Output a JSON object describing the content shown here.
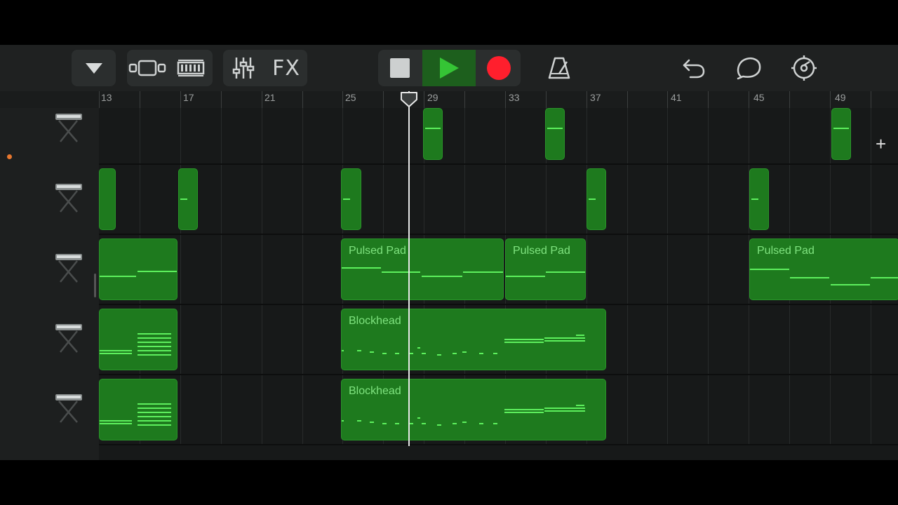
{
  "toolbar": {
    "fx_label": "FX",
    "icons": [
      "dropdown-triangle-icon",
      "tracks-view-icon",
      "live-loops-icon",
      "mixer-icon",
      "stop-icon",
      "play-icon",
      "record-icon",
      "metronome-icon",
      "undo-icon",
      "loop-browser-icon",
      "settings-gear-icon"
    ],
    "colors": {
      "play": "#35c435",
      "record": "#ff1f2d",
      "play_bg": "#1d5f1d"
    }
  },
  "ruler": {
    "bars": [
      "13",
      "17",
      "21",
      "25",
      "29",
      "33",
      "37",
      "41",
      "45",
      "49"
    ],
    "add_label": "+"
  },
  "tracks": [
    {
      "name": "keyboard-track-1",
      "instrument_icon": "keyboard-stand-icon"
    },
    {
      "name": "keyboard-track-2",
      "instrument_icon": "keyboard-stand-icon"
    },
    {
      "name": "keyboard-track-3",
      "instrument_icon": "keyboard-stand-icon"
    },
    {
      "name": "keyboard-track-4",
      "instrument_icon": "keyboard-stand-icon"
    },
    {
      "name": "keyboard-track-5",
      "instrument_icon": "keyboard-stand-icon"
    }
  ],
  "regions": {
    "pulsed_pad_label": "Pulsed Pad",
    "blockhead_label": "Blockhead"
  },
  "colors": {
    "region": "#1e7a1e",
    "note": "#5df05d",
    "label": "#7fe37f"
  }
}
